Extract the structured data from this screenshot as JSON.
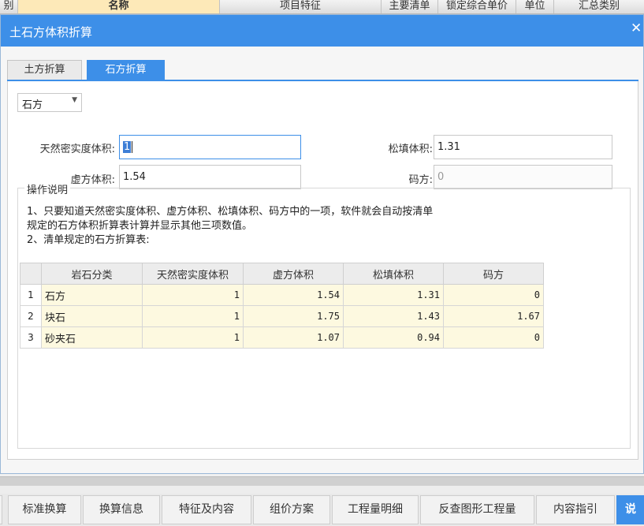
{
  "top_header": {
    "columns": [
      {
        "label": "别",
        "highlighted": false
      },
      {
        "label": "名称",
        "highlighted": true
      },
      {
        "label": "项目特征",
        "highlighted": false
      },
      {
        "label": "主要清单",
        "highlighted": false
      },
      {
        "label": "锁定综合单价",
        "highlighted": false
      },
      {
        "label": "单位",
        "highlighted": false
      },
      {
        "label": "汇总类别",
        "highlighted": false
      }
    ]
  },
  "dialog": {
    "title": "土石方体积折算",
    "close_icon": "close-icon",
    "tabs": [
      {
        "label": "土方折算",
        "active": false
      },
      {
        "label": "石方折算",
        "active": true
      }
    ],
    "type_select": {
      "value": "石方"
    },
    "fields": {
      "natural_label": "天然密实度体积:",
      "natural_value": "1",
      "loose_fill_label": "松填体积:",
      "loose_fill_value": "1.31",
      "virtual_label": "虚方体积:",
      "virtual_value": "1.54",
      "stacked_label": "码方:",
      "stacked_value": "0"
    },
    "instructions": {
      "title": "操作说明",
      "line1": "1、只要知道天然密实度体积、虚方体积、松填体积、码方中的一项，软件就会自动按清单",
      "line2": "规定的石方体积折算表计算并显示其他三项数值。",
      "line3": "2、清单规定的石方折算表:"
    },
    "table": {
      "headers": [
        "岩石分类",
        "天然密实度体积",
        "虚方体积",
        "松填体积",
        "码方"
      ],
      "rows": [
        {
          "idx": "1",
          "name": "石方",
          "natural": "1",
          "virtual": "1.54",
          "loose": "1.31",
          "stacked": "0"
        },
        {
          "idx": "2",
          "name": "块石",
          "natural": "1",
          "virtual": "1.75",
          "loose": "1.43",
          "stacked": "1.67"
        },
        {
          "idx": "3",
          "name": "砂夹石",
          "natural": "1",
          "virtual": "1.07",
          "loose": "0.94",
          "stacked": "0"
        }
      ]
    }
  },
  "bottom_tabs": [
    {
      "label": "标准换算",
      "active": false
    },
    {
      "label": "换算信息",
      "active": false
    },
    {
      "label": "特征及内容",
      "active": false
    },
    {
      "label": "组价方案",
      "active": false
    },
    {
      "label": "工程量明细",
      "active": false
    },
    {
      "label": "反查图形工程量",
      "active": false
    },
    {
      "label": "内容指引",
      "active": false
    },
    {
      "label": "说",
      "active": true
    }
  ],
  "colors": {
    "accent": "#3d8fe8",
    "table_cell_bg": "#fdf9e0",
    "header_highlight": "#fde9b8"
  }
}
